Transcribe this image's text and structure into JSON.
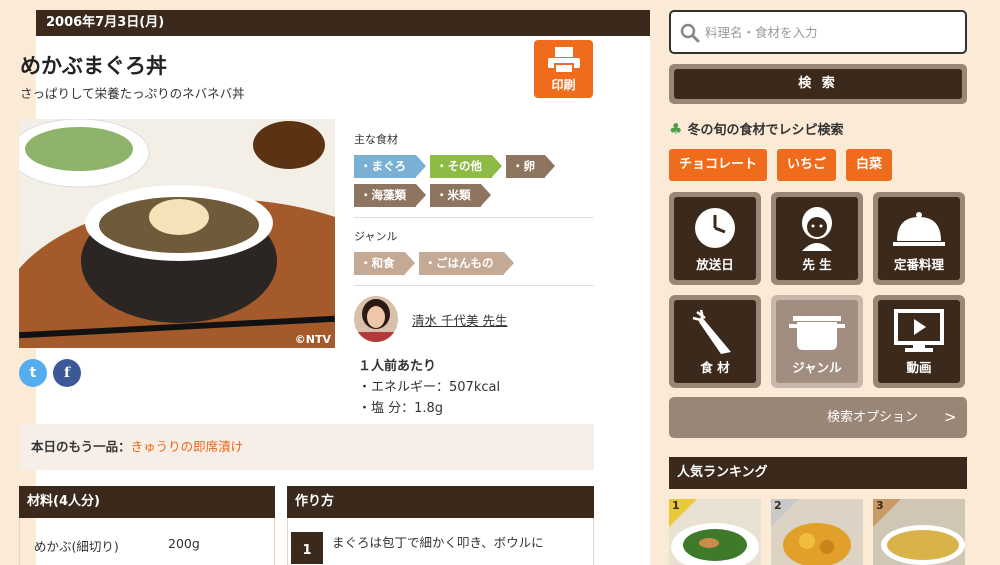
{
  "recipe": {
    "date": "2006年7月3日(月)",
    "title": "めかぶまぐろ丼",
    "subtitle": "さっぱりして栄養たっぷりのネバネバ丼",
    "print_label": "印刷",
    "photo_logo": "©NTV",
    "social": {
      "twitter": "t",
      "facebook": "f"
    },
    "main_ingredients_label": "主な食材",
    "main_ingredients": [
      "・まぐろ",
      "・その他",
      "・卵",
      "・海藻類",
      "・米類"
    ],
    "genre_label": "ジャンル",
    "genres": [
      "・和食",
      "・ごはんもの"
    ],
    "teacher": "清水 千代美 先生",
    "nutrition": {
      "heading": "１人前あたり",
      "energy": "・エネルギー：507kcal",
      "salt": "・塩 分：1.8g"
    },
    "another_dish": {
      "label": "本日のもう一品：",
      "link": "きゅうりの即席漬け"
    },
    "ingredients_header": "材料(4人分)",
    "ingredients": [
      {
        "name": "めかぶ(細切り)",
        "qty": "200g"
      }
    ],
    "howto_header": "作り方",
    "steps": [
      {
        "num": "1",
        "text": "まぐろは包丁で細かく叩き、ボウルに"
      }
    ]
  },
  "sidebar": {
    "search_placeholder": "料理名・食材を入力",
    "search_button": "検 索",
    "seasonal_heading": "冬の旬の食材でレシピ検索",
    "seasonal_items": [
      "チョコレート",
      "いちご",
      "白菜"
    ],
    "categories": [
      "放送日",
      "先 生",
      "定番料理",
      "食 材",
      "ジャンル",
      "動画"
    ],
    "search_option": "検索オプション",
    "search_option_arrow": ">",
    "ranking_heading": "人気ランキング",
    "ranking": [
      "1",
      "2",
      "3"
    ]
  },
  "colors": {
    "accent": "#ee6c1c",
    "dark": "#3b2a1c",
    "panel": "#9a8677"
  }
}
